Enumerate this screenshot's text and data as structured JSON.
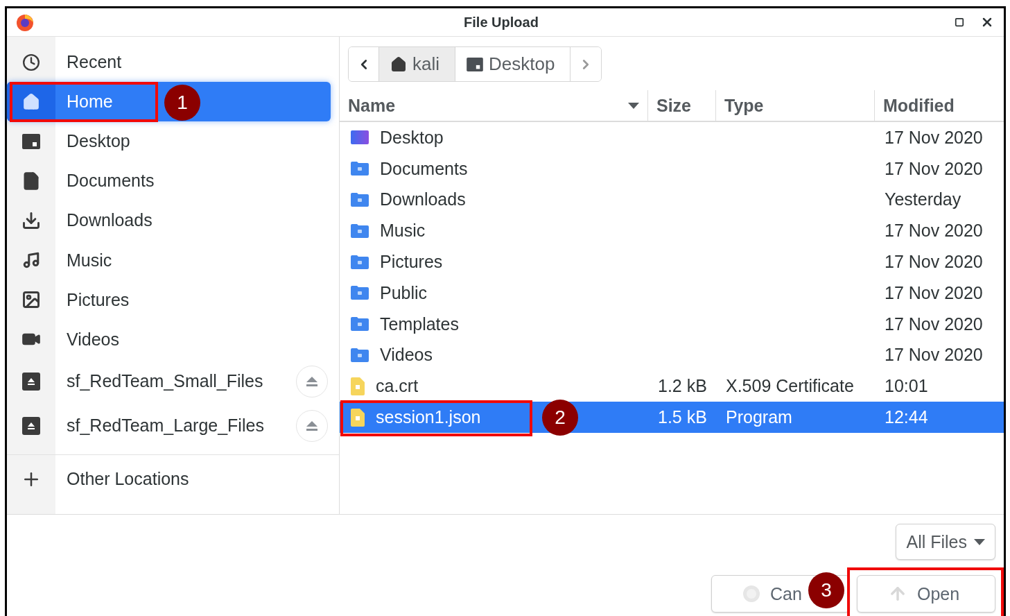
{
  "window": {
    "title": "File Upload"
  },
  "sidebar": {
    "places": [
      {
        "label": "Recent",
        "kind": "recent",
        "selected": false
      },
      {
        "label": "Home",
        "kind": "home",
        "selected": true
      },
      {
        "label": "Desktop",
        "kind": "desktop",
        "selected": false
      },
      {
        "label": "Documents",
        "kind": "documents",
        "selected": false
      },
      {
        "label": "Downloads",
        "kind": "downloads",
        "selected": false
      },
      {
        "label": "Music",
        "kind": "music",
        "selected": false
      },
      {
        "label": "Pictures",
        "kind": "pictures",
        "selected": false
      },
      {
        "label": "Videos",
        "kind": "videos",
        "selected": false
      }
    ],
    "drives": [
      {
        "label": "sf_RedTeam_Small_Files"
      },
      {
        "label": "sf_RedTeam_Large_Files"
      }
    ],
    "other": {
      "label": "Other Locations"
    }
  },
  "path_bar": {
    "segments": [
      {
        "label": "kali",
        "kind": "home",
        "selected": true
      },
      {
        "label": "Desktop",
        "kind": "desktop",
        "selected": false
      }
    ]
  },
  "table": {
    "columns": [
      {
        "label": "Name",
        "sorted": true
      },
      {
        "label": "Size",
        "sorted": false
      },
      {
        "label": "Type",
        "sorted": false
      },
      {
        "label": "Modified",
        "sorted": false
      }
    ],
    "rows": [
      {
        "name": "Desktop",
        "kind": "desktop",
        "modified": "17 Nov 2020",
        "selected": false
      },
      {
        "name": "Documents",
        "kind": "folder",
        "modified": "17 Nov 2020",
        "selected": false
      },
      {
        "name": "Downloads",
        "kind": "folder",
        "modified": "Yesterday",
        "selected": false
      },
      {
        "name": "Music",
        "kind": "folder",
        "modified": "17 Nov 2020",
        "selected": false
      },
      {
        "name": "Pictures",
        "kind": "folder",
        "modified": "17 Nov 2020",
        "selected": false
      },
      {
        "name": "Public",
        "kind": "folder",
        "modified": "17 Nov 2020",
        "selected": false
      },
      {
        "name": "Templates",
        "kind": "folder",
        "modified": "17 Nov 2020",
        "selected": false
      },
      {
        "name": "Videos",
        "kind": "folder",
        "modified": "17 Nov 2020",
        "selected": false
      },
      {
        "name": "ca.crt",
        "kind": "file",
        "size": "1.2 kB",
        "type": "X.509 Certificate",
        "modified": "10:01",
        "selected": false
      },
      {
        "name": "session1.json",
        "kind": "file",
        "size": "1.5 kB",
        "type": "Program",
        "modified": "12:44",
        "selected": true
      }
    ]
  },
  "filter": {
    "label": "All Files"
  },
  "buttons": [
    {
      "label": "Can",
      "kind": "cancel"
    },
    {
      "label": "Open",
      "kind": "open"
    }
  ],
  "annotations": [
    {
      "label": "1"
    },
    {
      "label": "2"
    },
    {
      "label": "3"
    }
  ]
}
